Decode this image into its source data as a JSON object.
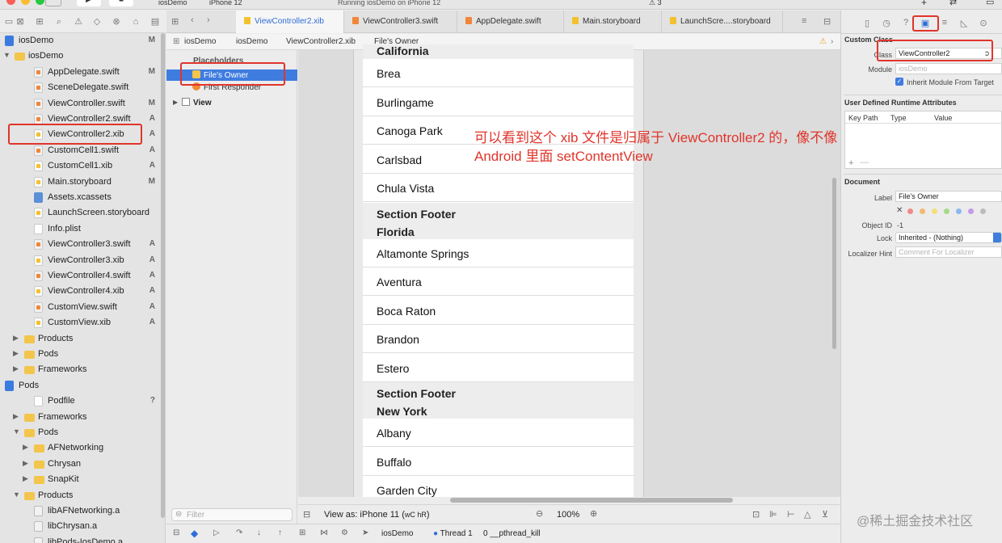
{
  "toolbar": {
    "scheme": "iosDemo",
    "device": "iPhone 12",
    "status": "Running iosDemo on iPhone 12",
    "warnings": "3"
  },
  "navigator": {
    "items": [
      {
        "label": "iosDemo",
        "icon": "blue",
        "badge": "M",
        "level": 0,
        "tri": ""
      },
      {
        "label": "iosDemo",
        "icon": "folder",
        "badge": "",
        "level": 0,
        "tri": "▼"
      },
      {
        "label": "AppDelegate.swift",
        "icon": "swift",
        "badge": "M",
        "level": 2,
        "tri": ""
      },
      {
        "label": "SceneDelegate.swift",
        "icon": "swift",
        "badge": "",
        "level": 2,
        "tri": ""
      },
      {
        "label": "ViewController.swift",
        "icon": "swift",
        "badge": "M",
        "level": 2,
        "tri": ""
      },
      {
        "label": "ViewController2.swift",
        "icon": "swift",
        "badge": "A",
        "level": 2,
        "tri": ""
      },
      {
        "label": "ViewController2.xib",
        "icon": "xib",
        "badge": "A",
        "level": 2,
        "tri": ""
      },
      {
        "label": "CustomCell1.swift",
        "icon": "swift",
        "badge": "A",
        "level": 2,
        "tri": ""
      },
      {
        "label": "CustomCell1.xib",
        "icon": "xib",
        "badge": "A",
        "level": 2,
        "tri": ""
      },
      {
        "label": "Main.storyboard",
        "icon": "xib",
        "badge": "M",
        "level": 2,
        "tri": ""
      },
      {
        "label": "Assets.xcassets",
        "icon": "assets",
        "badge": "",
        "level": 2,
        "tri": ""
      },
      {
        "label": "LaunchScreen.storyboard",
        "icon": "xib",
        "badge": "",
        "level": 2,
        "tri": ""
      },
      {
        "label": "Info.plist",
        "icon": "plain",
        "badge": "",
        "level": 2,
        "tri": ""
      },
      {
        "label": "ViewController3.swift",
        "icon": "swift",
        "badge": "A",
        "level": 2,
        "tri": ""
      },
      {
        "label": "ViewController3.xib",
        "icon": "xib",
        "badge": "A",
        "level": 2,
        "tri": ""
      },
      {
        "label": "ViewController4.swift",
        "icon": "swift",
        "badge": "A",
        "level": 2,
        "tri": ""
      },
      {
        "label": "ViewController4.xib",
        "icon": "xib",
        "badge": "A",
        "level": 2,
        "tri": ""
      },
      {
        "label": "CustomView.swift",
        "icon": "swift",
        "badge": "A",
        "level": 2,
        "tri": ""
      },
      {
        "label": "CustomView.xib",
        "icon": "xib",
        "badge": "A",
        "level": 2,
        "tri": ""
      },
      {
        "label": "Products",
        "icon": "folder",
        "badge": "",
        "level": 1,
        "tri": "▶"
      },
      {
        "label": "Pods",
        "icon": "folder",
        "badge": "",
        "level": 1,
        "tri": "▶"
      },
      {
        "label": "Frameworks",
        "icon": "folder",
        "badge": "",
        "level": 1,
        "tri": "▶"
      },
      {
        "label": "Pods",
        "icon": "blue",
        "badge": "",
        "level": 0,
        "tri": ""
      },
      {
        "label": "Podfile",
        "icon": "plain",
        "badge": "?",
        "level": 2,
        "tri": ""
      },
      {
        "label": "Frameworks",
        "icon": "folder",
        "badge": "",
        "level": 1,
        "tri": "▶"
      },
      {
        "label": "Pods",
        "icon": "folder",
        "badge": "",
        "level": 1,
        "tri": "▼"
      },
      {
        "label": "AFNetworking",
        "icon": "folder",
        "badge": "",
        "level": 2,
        "tri": "▶"
      },
      {
        "label": "Chrysan",
        "icon": "folder",
        "badge": "",
        "level": 2,
        "tri": "▶"
      },
      {
        "label": "SnapKit",
        "icon": "folder",
        "badge": "",
        "level": 2,
        "tri": "▶"
      },
      {
        "label": "Products",
        "icon": "folder",
        "badge": "",
        "level": 1,
        "tri": "▼"
      },
      {
        "label": "libAFNetworking.a",
        "icon": "lib",
        "badge": "",
        "level": 2,
        "tri": ""
      },
      {
        "label": "libChrysan.a",
        "icon": "lib",
        "badge": "",
        "level": 2,
        "tri": ""
      },
      {
        "label": "libPods-IosDemo.a",
        "icon": "lib",
        "badge": "",
        "level": 2,
        "tri": ""
      }
    ],
    "filter_placeholder": "Filter"
  },
  "tabs": [
    {
      "label": "ViewController2.xib",
      "active": true
    },
    {
      "label": "ViewController3.swift",
      "active": false
    },
    {
      "label": "AppDelegate.swift",
      "active": false
    },
    {
      "label": "Main.storyboard",
      "active": false
    },
    {
      "label": "LaunchScre....storyboard",
      "active": false
    }
  ],
  "jumpbar": [
    "iosDemo",
    "iosDemo",
    "ViewController2.xib",
    "File's Owner"
  ],
  "outline": {
    "placeholders": "Placeholders",
    "files_owner": "File's Owner",
    "first_responder": "First Responder",
    "view": "View"
  },
  "table": {
    "top_header": "California",
    "sections": [
      {
        "cells": [
          "Brea",
          "Burlingame",
          "Canoga Park",
          "Carlsbad",
          "Chula Vista"
        ],
        "footer": "Section Footer",
        "next_header": "Florida"
      },
      {
        "cells": [
          "Altamonte Springs",
          "Aventura",
          "Boca Raton",
          "Brandon",
          "Estero"
        ],
        "footer": "Section Footer",
        "next_header": "New York"
      },
      {
        "cells": [
          "Albany",
          "Buffalo",
          "Garden City"
        ],
        "footer": "",
        "next_header": ""
      }
    ]
  },
  "annotation": {
    "line1": "可以看到这个 xib 文件是归属于 ViewController2 的，像不像",
    "line2": "Android 里面 setContentView"
  },
  "canvas_bottom": {
    "view_as": "View as: iPhone 11 (",
    "view_as_traits": "wC hR",
    "view_as_end": ")",
    "zoom": "100%"
  },
  "debugbar": {
    "target": "iosDemo",
    "thread": "Thread 1",
    "frame": "0 __pthread_kill"
  },
  "inspector": {
    "custom_class_title": "Custom Class",
    "class_label": "Class",
    "class_value": "ViewController2",
    "module_label": "Module",
    "module_placeholder": "iosDemo",
    "inherit_label": "Inherit Module From Target",
    "runtime_title": "User Defined Runtime Attributes",
    "col_keypath": "Key Path",
    "col_type": "Type",
    "col_value": "Value",
    "document_title": "Document",
    "label_label": "Label",
    "label_value": "File's Owner",
    "object_id_label": "Object ID",
    "object_id_value": "-1",
    "lock_label": "Lock",
    "lock_value": "Inherited - (Nothing)",
    "hint_label": "Localizer Hint",
    "hint_placeholder": "Comment For Localizer"
  },
  "watermark": "@稀土掘金技术社区",
  "colors": {
    "accent": "#3f7ce0",
    "annotation": "#e0352b"
  }
}
